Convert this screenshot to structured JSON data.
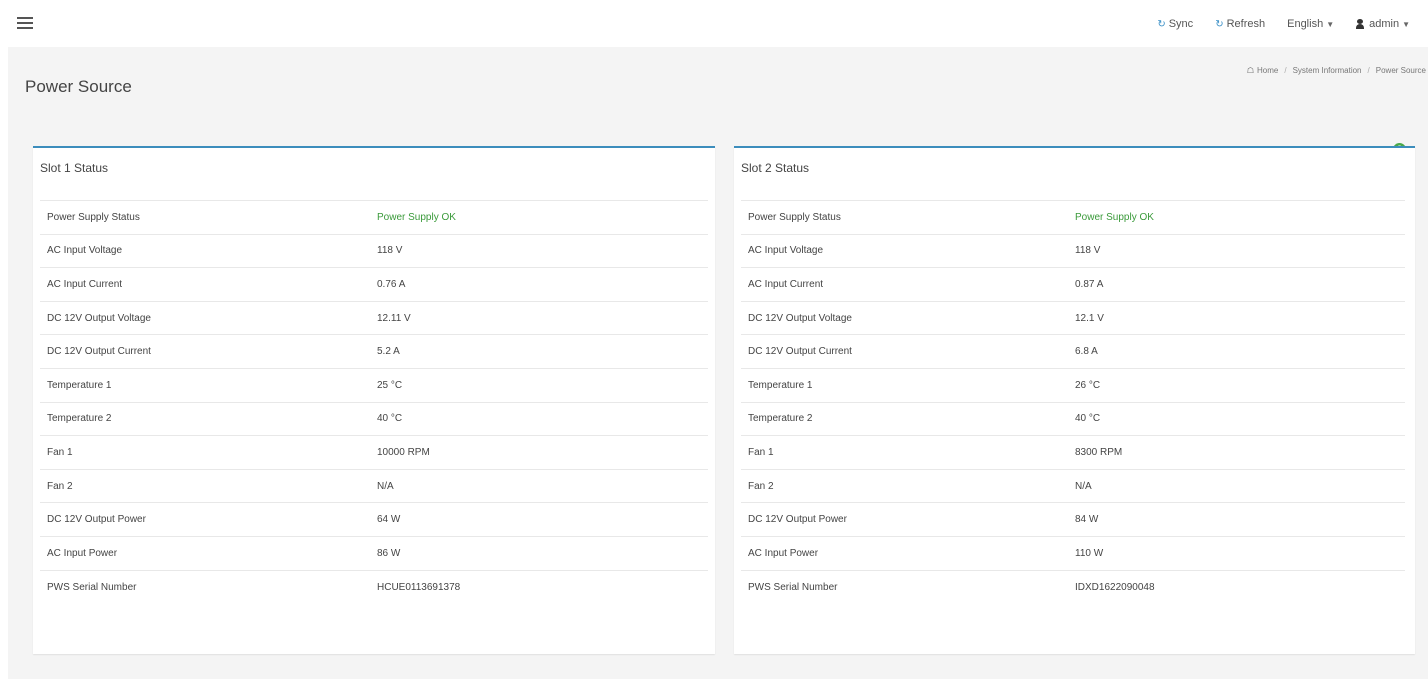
{
  "header": {
    "sync_label": "Sync",
    "refresh_label": "Refresh",
    "language_label": "English",
    "user_label": "admin"
  },
  "page": {
    "title": "Power Source",
    "breadcrumb": {
      "home": "Home",
      "parent": "System Information",
      "current": "Power Source"
    },
    "help_glyph": "?"
  },
  "slots": [
    {
      "title": "Slot 1 Status",
      "rows": [
        {
          "label": "Power Supply Status",
          "value": "Power Supply OK"
        },
        {
          "label": "AC Input Voltage",
          "value": "118 V"
        },
        {
          "label": "AC Input Current",
          "value": "0.76 A"
        },
        {
          "label": "DC 12V Output Voltage",
          "value": "12.11 V"
        },
        {
          "label": "DC 12V Output Current",
          "value": "5.2 A"
        },
        {
          "label": "Temperature 1",
          "value": "25 °C"
        },
        {
          "label": "Temperature 2",
          "value": "40 °C"
        },
        {
          "label": "Fan 1",
          "value": "10000 RPM"
        },
        {
          "label": "Fan 2",
          "value": "N/A"
        },
        {
          "label": "DC 12V Output Power",
          "value": "64 W"
        },
        {
          "label": "AC Input Power",
          "value": "86 W"
        },
        {
          "label": "PWS Serial Number",
          "value": "HCUE0113691378"
        }
      ]
    },
    {
      "title": "Slot 2 Status",
      "rows": [
        {
          "label": "Power Supply Status",
          "value": "Power Supply OK"
        },
        {
          "label": "AC Input Voltage",
          "value": "118 V"
        },
        {
          "label": "AC Input Current",
          "value": "0.87 A"
        },
        {
          "label": "DC 12V Output Voltage",
          "value": "12.1 V"
        },
        {
          "label": "DC 12V Output Current",
          "value": "6.8 A"
        },
        {
          "label": "Temperature 1",
          "value": "26 °C"
        },
        {
          "label": "Temperature 2",
          "value": "40 °C"
        },
        {
          "label": "Fan 1",
          "value": "8300 RPM"
        },
        {
          "label": "Fan 2",
          "value": "N/A"
        },
        {
          "label": "DC 12V Output Power",
          "value": "84 W"
        },
        {
          "label": "AC Input Power",
          "value": "110 W"
        },
        {
          "label": "PWS Serial Number",
          "value": "IDXD1622090048"
        }
      ]
    }
  ],
  "colors": {
    "accent": "#3c8dbc",
    "status_ok": "#3a9a3a",
    "help": "#4aa84a"
  }
}
